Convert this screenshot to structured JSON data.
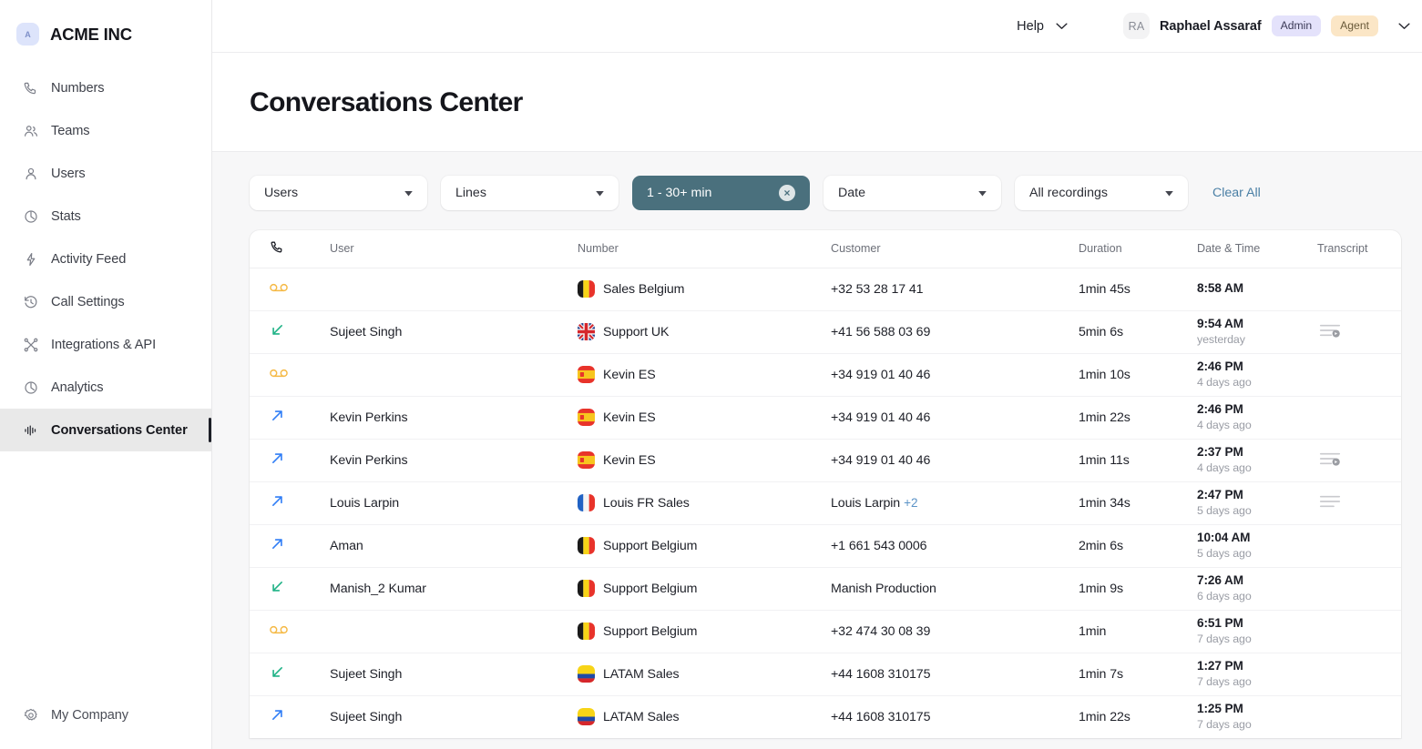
{
  "sidebar": {
    "brand": {
      "badge_letter": "A",
      "name": "ACME INC"
    },
    "items": [
      {
        "label": "Numbers",
        "icon": "phone-icon"
      },
      {
        "label": "Teams",
        "icon": "team-icon"
      },
      {
        "label": "Users",
        "icon": "user-icon"
      },
      {
        "label": "Stats",
        "icon": "pie-chart-icon"
      },
      {
        "label": "Activity Feed",
        "icon": "activity-icon"
      },
      {
        "label": "Call Settings",
        "icon": "history-icon"
      },
      {
        "label": "Integrations & API",
        "icon": "integrations-icon"
      },
      {
        "label": "Analytics",
        "icon": "pie-chart-icon"
      },
      {
        "label": "Conversations Center",
        "icon": "waveform-icon",
        "active": true
      }
    ],
    "footer": {
      "label": "My Company",
      "icon": "gear-icon"
    }
  },
  "topbar": {
    "help_label": "Help",
    "avatar_initials": "RA",
    "user_name": "Raphael Assaraf",
    "badges": [
      {
        "label": "Admin",
        "color": "#e4e2fb"
      },
      {
        "label": "Agent",
        "color": "#fbe6c6"
      }
    ]
  },
  "page": {
    "title": "Conversations Center"
  },
  "filters": {
    "users": {
      "label": "Users",
      "active": false
    },
    "lines": {
      "label": "Lines",
      "active": false
    },
    "duration": {
      "label": "1 - 30+ min",
      "active": true,
      "chip_color": "#4a707d"
    },
    "date": {
      "label": "Date",
      "active": false
    },
    "recordings": {
      "label": "All recordings",
      "active": false
    },
    "clear_all": "Clear All"
  },
  "table": {
    "headers": {
      "type": "",
      "user": "User",
      "number": "Number",
      "customer": "Customer",
      "duration": "Duration",
      "datetime": "Date & Time",
      "transcript": "Transcript"
    },
    "rows": [
      {
        "call_type": "voicemail",
        "user": "",
        "flag": "be",
        "number": "Sales Belgium",
        "customer": "+32 53 28 17 41",
        "customer_extra": "",
        "duration": "1min 45s",
        "time": "8:58 AM",
        "relative": "",
        "transcript": "none"
      },
      {
        "call_type": "incoming",
        "user": "Sujeet Singh",
        "flag": "gb",
        "number": "Support UK",
        "customer": "+41 56 588 03 69",
        "customer_extra": "",
        "duration": "5min 6s",
        "time": "9:54 AM",
        "relative": "yesterday",
        "transcript": "recorded"
      },
      {
        "call_type": "voicemail",
        "user": "",
        "flag": "es",
        "number": "Kevin ES",
        "customer": "+34 919 01 40 46",
        "customer_extra": "",
        "duration": "1min 10s",
        "time": "2:46 PM",
        "relative": "4 days ago",
        "transcript": "none"
      },
      {
        "call_type": "outgoing",
        "user": "Kevin Perkins",
        "flag": "es",
        "number": "Kevin ES",
        "customer": "+34 919 01 40 46",
        "customer_extra": "",
        "duration": "1min 22s",
        "time": "2:46 PM",
        "relative": "4 days ago",
        "transcript": "none"
      },
      {
        "call_type": "outgoing",
        "user": "Kevin Perkins",
        "flag": "es",
        "number": "Kevin ES",
        "customer": "+34 919 01 40 46",
        "customer_extra": "",
        "duration": "1min 11s",
        "time": "2:37 PM",
        "relative": "4 days ago",
        "transcript": "recorded"
      },
      {
        "call_type": "outgoing",
        "user": "Louis Larpin",
        "flag": "fr",
        "number": "Louis FR Sales",
        "customer": "Louis Larpin",
        "customer_extra": "+2",
        "duration": "1min 34s",
        "time": "2:47 PM",
        "relative": "5 days ago",
        "transcript": "text"
      },
      {
        "call_type": "outgoing",
        "user": "Aman",
        "flag": "be",
        "number": "Support Belgium",
        "customer": "+1 661 543 0006",
        "customer_extra": "",
        "duration": "2min 6s",
        "time": "10:04 AM",
        "relative": "5 days ago",
        "transcript": "none"
      },
      {
        "call_type": "incoming",
        "user": "Manish_2 Kumar",
        "flag": "be",
        "number": "Support Belgium",
        "customer": "Manish Production",
        "customer_extra": "",
        "duration": "1min 9s",
        "time": "7:26 AM",
        "relative": "6 days ago",
        "transcript": "none"
      },
      {
        "call_type": "voicemail",
        "user": "",
        "flag": "be",
        "number": "Support Belgium",
        "customer": "+32 474 30 08 39",
        "customer_extra": "",
        "duration": "1min",
        "time": "6:51 PM",
        "relative": "7 days ago",
        "transcript": "none"
      },
      {
        "call_type": "incoming",
        "user": "Sujeet Singh",
        "flag": "co",
        "number": "LATAM Sales",
        "customer": "+44 1608 310175",
        "customer_extra": "",
        "duration": "1min 7s",
        "time": "1:27 PM",
        "relative": "7 days ago",
        "transcript": "none"
      },
      {
        "call_type": "outgoing",
        "user": "Sujeet Singh",
        "flag": "co",
        "number": "LATAM Sales",
        "customer": "+44 1608 310175",
        "customer_extra": "",
        "duration": "1min 22s",
        "time": "1:25 PM",
        "relative": "7 days ago",
        "transcript": "none"
      }
    ]
  },
  "colors": {
    "incoming": "#1fb286",
    "outgoing": "#2f7df6",
    "voicemail": "#f5b945",
    "active_filter": "#4a707d",
    "link": "#4a7fa5"
  }
}
